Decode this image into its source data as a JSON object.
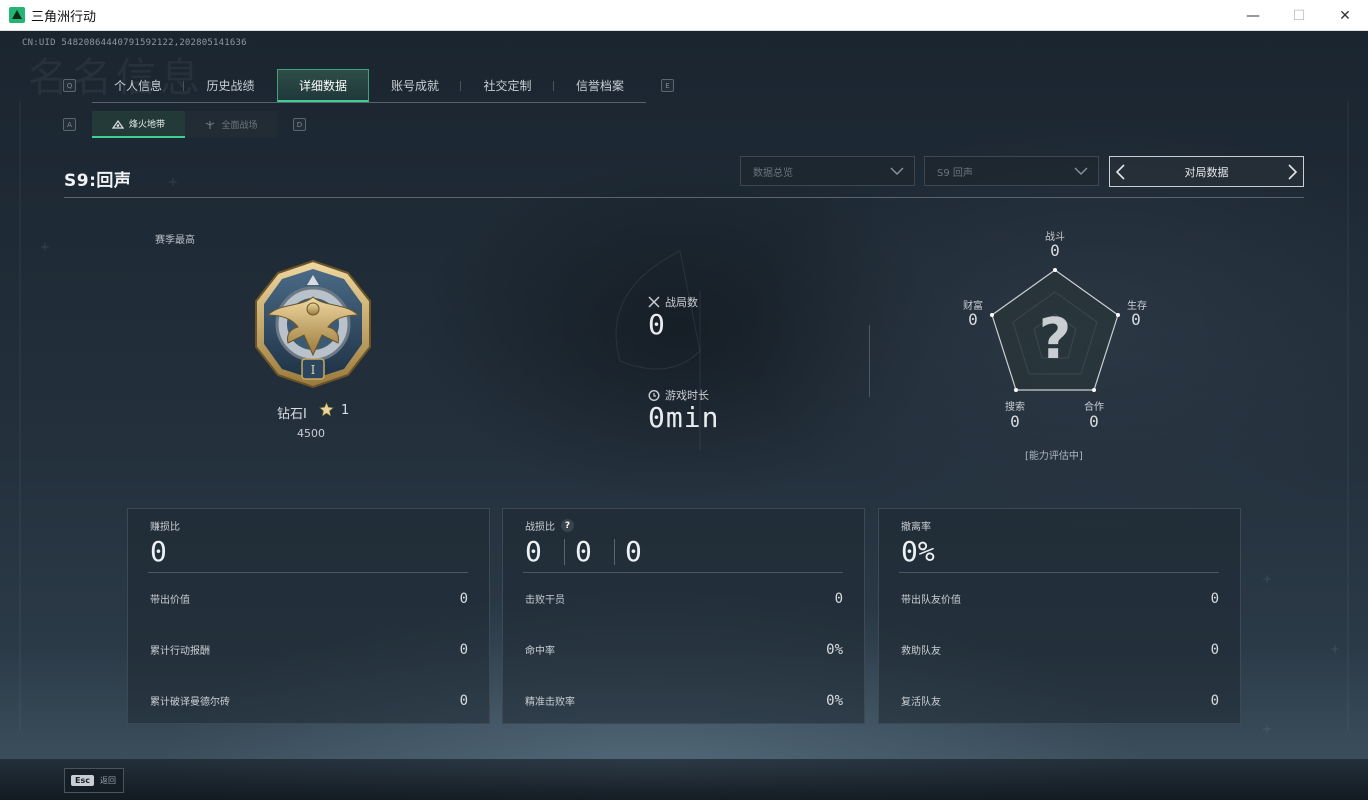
{
  "window": {
    "title": "三角洲行动",
    "minimize": "—",
    "maximize": "☐",
    "close": "✕"
  },
  "uid": "CN:UID 548208644407915921​22,202805141636",
  "top_tabs": {
    "left_key": "Q",
    "right_key": "E",
    "items": [
      {
        "label": "个人信息"
      },
      {
        "label": "历史战绩"
      },
      {
        "label": "详细数据",
        "active": true
      },
      {
        "label": "账号成就"
      },
      {
        "label": "社交定制"
      },
      {
        "label": "信誉档案"
      }
    ]
  },
  "sub_tabs": {
    "left_key": "A",
    "right_key": "D",
    "items": [
      {
        "label": "烽火地带",
        "active": true
      },
      {
        "label": "全面战场"
      }
    ]
  },
  "season_title": "S9:回声",
  "filters": {
    "overview_dropdown": "数据总览",
    "season_dropdown": "S9 回声",
    "pager_label": "对局数据"
  },
  "rank": {
    "season_best_label": "赛季最高",
    "name": "钻石Ⅰ",
    "stars": "1",
    "score": "4500",
    "medal_numeral": "I"
  },
  "summary": {
    "matches_label": "战局数",
    "matches_value": "0",
    "playtime_label": "游戏时长",
    "playtime_value": "0min"
  },
  "radar": {
    "center_mark": "?",
    "ability_status": "[能力评估中]",
    "axes": [
      {
        "label": "战斗",
        "value": "0"
      },
      {
        "label": "生存",
        "value": "0"
      },
      {
        "label": "合作",
        "value": "0"
      },
      {
        "label": "搜索",
        "value": "0"
      },
      {
        "label": "财富",
        "value": "0"
      }
    ]
  },
  "panels": [
    {
      "title": "赚损比",
      "big": "0",
      "rows": [
        {
          "label": "带出价值",
          "value": "0"
        },
        {
          "label": "累计行动报酬",
          "value": "0"
        },
        {
          "label": "累计破译曼德尔砖",
          "value": "0"
        }
      ]
    },
    {
      "title": "战损比",
      "help": "?",
      "ratio": [
        "0",
        "0",
        "0"
      ],
      "rows": [
        {
          "label": "击败干员",
          "value": "0"
        },
        {
          "label": "命中率",
          "value": "0%"
        },
        {
          "label": "精准击败率",
          "value": "0%"
        }
      ]
    },
    {
      "title": "撤离率",
      "big": "0%",
      "rows": [
        {
          "label": "带出队友价值",
          "value": "0"
        },
        {
          "label": "救助队友",
          "value": "0"
        },
        {
          "label": "复活队友",
          "value": "0"
        }
      ]
    }
  ],
  "footer": {
    "esc_key": "Esc",
    "back_label": "返回"
  },
  "colors": {
    "accent": "#3fd08f",
    "bg": "#1f2b36"
  }
}
